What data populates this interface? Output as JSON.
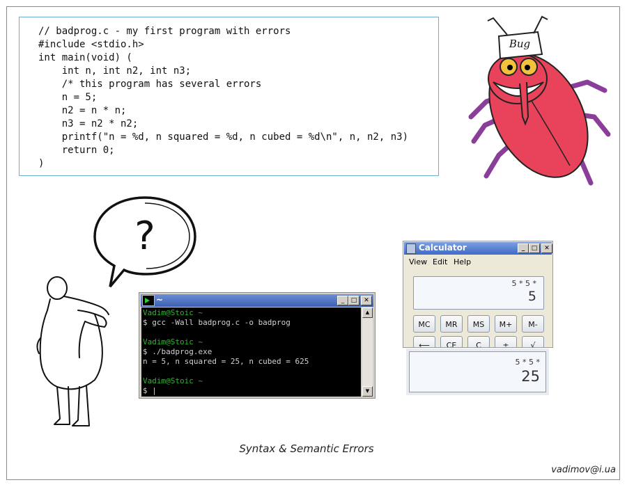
{
  "code": {
    "lines": [
      "// badprog.c - my first program with errors",
      "#include <stdio.h>",
      "int main(void) (",
      "    int n, int n2, int n3;",
      "    /* this program has several errors",
      "    n = 5;",
      "    n2 = n * n;",
      "    n3 = n2 * n2;",
      "    printf(\"n = %d, n squared = %d, n cubed = %d\\n\", n, n2, n3)",
      "    return 0;",
      ")"
    ]
  },
  "bug": {
    "label": "Bug",
    "body_color": "#e8435a",
    "leg_color": "#8a3e9a"
  },
  "bubble": {
    "symbol": "?"
  },
  "terminal": {
    "title": "~",
    "lines": [
      {
        "text": "Vadim@Stoic ~",
        "kind": "prompt"
      },
      {
        "text": "$ gcc -Wall badprog.c -o badprog",
        "kind": "output"
      },
      {
        "text": "",
        "kind": "output"
      },
      {
        "text": "Vadim@Stoic ~",
        "kind": "prompt"
      },
      {
        "text": "$ ./badprog.exe",
        "kind": "output"
      },
      {
        "text": "n = 5, n squared = 25, n cubed = 625",
        "kind": "output"
      },
      {
        "text": "",
        "kind": "output"
      },
      {
        "text": "Vadim@Stoic ~",
        "kind": "prompt"
      },
      {
        "text": "$ |",
        "kind": "output"
      }
    ],
    "minimize": "_",
    "maximize": "□",
    "close": "✕"
  },
  "calculator": {
    "title": "Calculator",
    "menu": [
      "View",
      "Edit",
      "Help"
    ],
    "expression": "5 * 5 *",
    "value": "5",
    "buttons_row1": [
      "MC",
      "MR",
      "MS",
      "M+",
      "M-"
    ],
    "buttons_row2": [
      "⟵",
      "CE",
      "C",
      "±",
      "√"
    ]
  },
  "result_display": {
    "expression": "5 * 5 *",
    "value": "25"
  },
  "caption": "Syntax & Semantic Errors",
  "author": "vadimov@i.ua"
}
